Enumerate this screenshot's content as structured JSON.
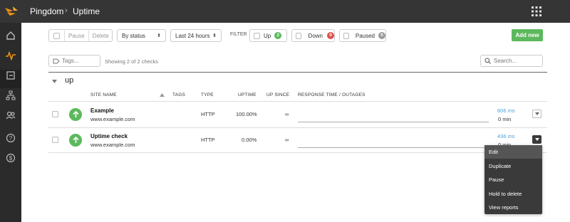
{
  "header": {
    "app_name": "Pingdom",
    "page_title": "Uptime"
  },
  "toolbar": {
    "pause_label": "Pause",
    "delete_label": "Delete",
    "status_select": "By status",
    "period_select": "Last 24 hours",
    "filter_label": "FILTER",
    "filters": [
      {
        "label": "Up",
        "count": "2",
        "color": "#5cb85c"
      },
      {
        "label": "Down",
        "count": "0",
        "color": "#d9534f"
      },
      {
        "label": "Paused",
        "count": "0",
        "color": "#999999"
      }
    ],
    "add_new_label": "Add new"
  },
  "search_row": {
    "tags_placeholder": "Tags...",
    "showing_text": "Showing 2 of 2 checks",
    "search_placeholder": "Search..."
  },
  "group": {
    "name": "up"
  },
  "table": {
    "columns": [
      "SITE NAME",
      "TAGS",
      "TYPE",
      "UPTIME",
      "UP SINCE",
      "RESPONSE TIME / OUTAGES"
    ],
    "rows": [
      {
        "name": "Example",
        "url": "www.example.com",
        "type": "HTTP",
        "uptime": "100.00%",
        "up_since": "∞",
        "response_ms": "606 ms",
        "outage": "0 min"
      },
      {
        "name": "Uptime check",
        "url": "www.example.com",
        "type": "HTTP",
        "uptime": "0.00%",
        "up_since": "∞",
        "response_ms": "436 ms",
        "outage": "0 min"
      }
    ]
  },
  "row_menu": {
    "items": [
      "Edit",
      "Duplicate",
      "Pause",
      "Hold to delete",
      "View reports"
    ]
  }
}
